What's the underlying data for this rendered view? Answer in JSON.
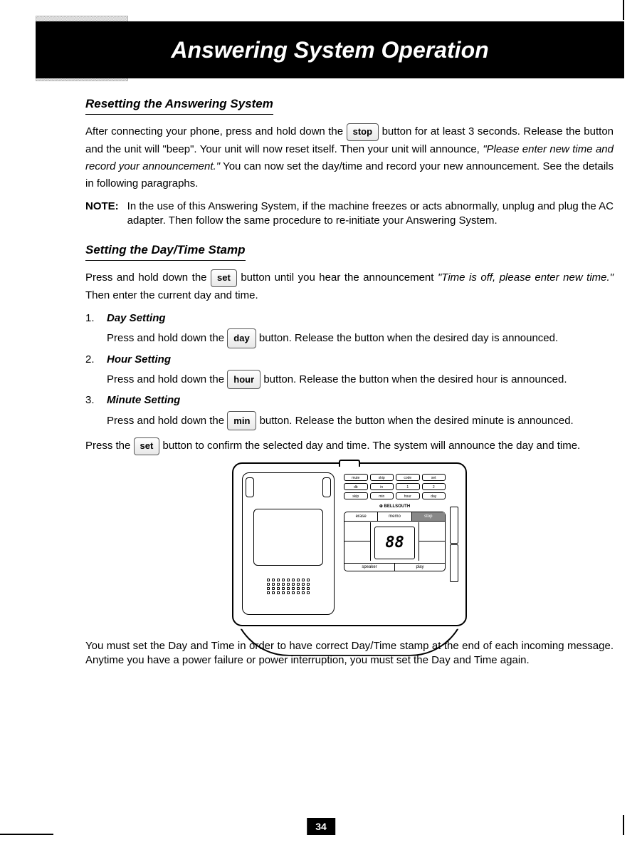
{
  "header": {
    "title": "Answering System Operation"
  },
  "section1": {
    "heading": "Resetting the Answering System",
    "p1a": "After connecting your phone, press and hold down the ",
    "btn_stop": "stop",
    "p1b": " button for at least 3 seconds. Release the button and the unit will \"beep\". Your unit will now reset itself. Then your unit will announce, ",
    "quote": "\"Please enter new time and record your announcement.\"",
    "p1c": " You can now set the day/time and record your new announcement. See the details in following paragraphs.",
    "note_label": "NOTE:",
    "note_text": "In the use of this Answering System, if the machine freezes or acts abnormally, unplug and plug the AC adapter. Then follow the same procedure to re-initiate your Answering System."
  },
  "section2": {
    "heading": "Setting the Day/Time Stamp",
    "intro_a": "Press and hold down the ",
    "btn_set": "set",
    "intro_b": " button until you hear the announcement ",
    "intro_quote": "\"Time is off, please enter new time.\"",
    "intro_c": " Then enter the current day and time.",
    "items": [
      {
        "num": "1.",
        "title": "Day Setting",
        "pre": "Press and hold down the ",
        "btn": "day",
        "post": " button. Release the button when the desired day is announced."
      },
      {
        "num": "2.",
        "title": "Hour Setting",
        "pre": "Press and hold down the ",
        "btn": "hour",
        "post": " button. Release the button when the desired hour is announced."
      },
      {
        "num": "3.",
        "title": "Minute Setting",
        "pre": "Press and hold down the ",
        "btn": "min",
        "post": " button. Release the button when the desired minute is announced."
      }
    ],
    "confirm_a": "Press the ",
    "confirm_btn": "set",
    "confirm_b": " button to confirm the selected day and time. The system will announce the day and time.",
    "closing": "You must set the Day and Time in order to have correct Day/Time stamp at the end of each incoming message. Anytime you have a power failure or power interruption, you must set the Day and Time again."
  },
  "device": {
    "brand": "BELLSOUTH",
    "top_buttons": [
      "mute",
      "skip",
      "code",
      "set",
      "db",
      "in",
      "1",
      "2",
      "skip",
      "min",
      "hour",
      "day"
    ],
    "controls": {
      "erase": "erase",
      "memo": "memo",
      "stop": "stop",
      "speaker": "speaker",
      "play": "play",
      "display": "88"
    }
  },
  "page_number": "34"
}
